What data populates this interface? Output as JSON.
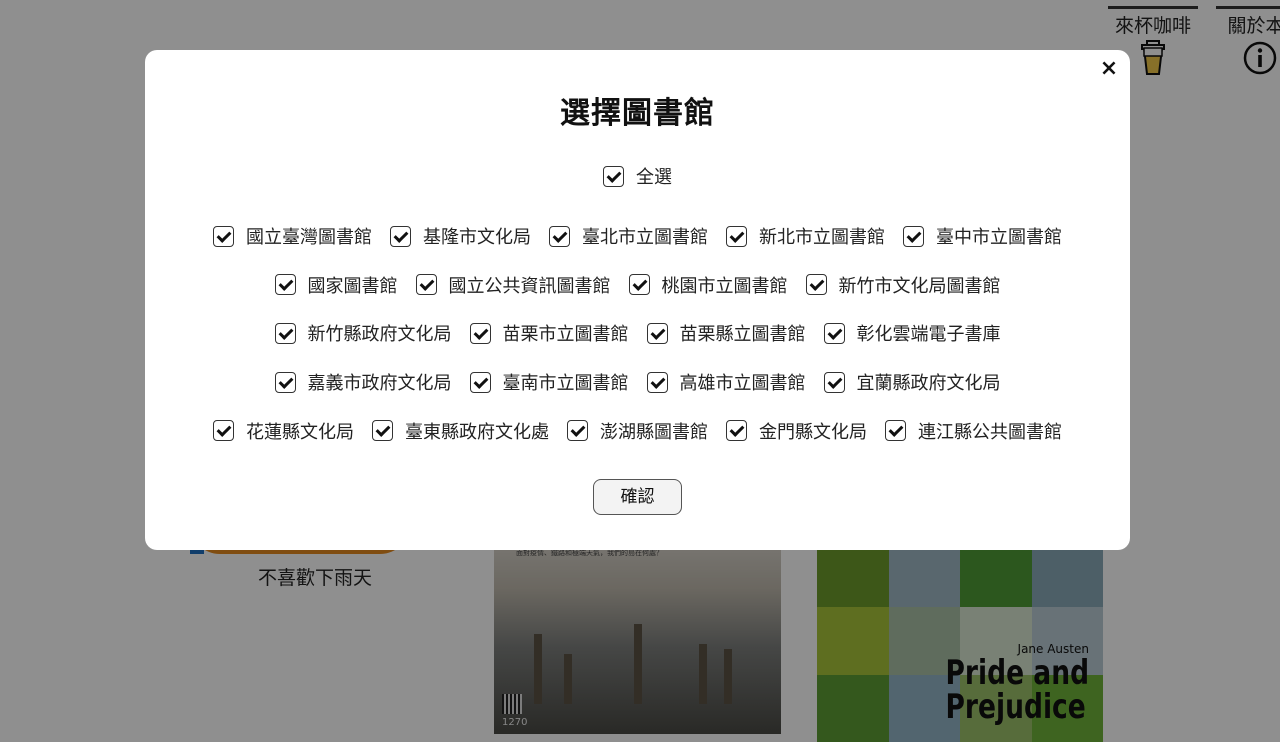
{
  "header": {
    "coffee_label": "來杯咖啡",
    "about_label": "關於本"
  },
  "books": [
    {
      "title": "不喜歡下雨天"
    },
    {
      "cover_caption": "面對疫情、鐵路和極端天氣，我們的島在何處？",
      "cover_number": "1270"
    },
    {
      "author": "Jane Austen",
      "title_line1": "Pride and",
      "title_line2": "Prejudice"
    }
  ],
  "modal": {
    "title": "選擇圖書館",
    "close_symbol": "×",
    "select_all_label": "全選",
    "confirm_label": "確認",
    "rows": [
      [
        {
          "label": "國立臺灣圖書館",
          "checked": true
        },
        {
          "label": "基隆市文化局",
          "checked": true
        },
        {
          "label": "臺北市立圖書館",
          "checked": true
        },
        {
          "label": "新北市立圖書館",
          "checked": true
        },
        {
          "label": "臺中市立圖書館",
          "checked": true
        }
      ],
      [
        {
          "label": "國家圖書館",
          "checked": true
        },
        {
          "label": "國立公共資訊圖書館",
          "checked": true
        },
        {
          "label": "桃園市立圖書館",
          "checked": true
        },
        {
          "label": "新竹市文化局圖書館",
          "checked": true
        }
      ],
      [
        {
          "label": "新竹縣政府文化局",
          "checked": true
        },
        {
          "label": "苗栗市立圖書館",
          "checked": true
        },
        {
          "label": "苗栗縣立圖書館",
          "checked": true
        },
        {
          "label": "彰化雲端電子書庫",
          "checked": true
        }
      ],
      [
        {
          "label": "嘉義市政府文化局",
          "checked": true
        },
        {
          "label": "臺南市立圖書館",
          "checked": true
        },
        {
          "label": "高雄市立圖書館",
          "checked": true
        },
        {
          "label": "宜蘭縣政府文化局",
          "checked": true
        }
      ],
      [
        {
          "label": "花蓮縣文化局",
          "checked": true
        },
        {
          "label": "臺東縣政府文化處",
          "checked": true
        },
        {
          "label": "澎湖縣圖書館",
          "checked": true
        },
        {
          "label": "金門縣文化局",
          "checked": true
        },
        {
          "label": "連江縣公共圖書館",
          "checked": true
        }
      ]
    ]
  },
  "colors": {
    "overlay": "#8f8f8f",
    "modal_bg": "#ffffff",
    "checkbox_border": "#333333"
  }
}
